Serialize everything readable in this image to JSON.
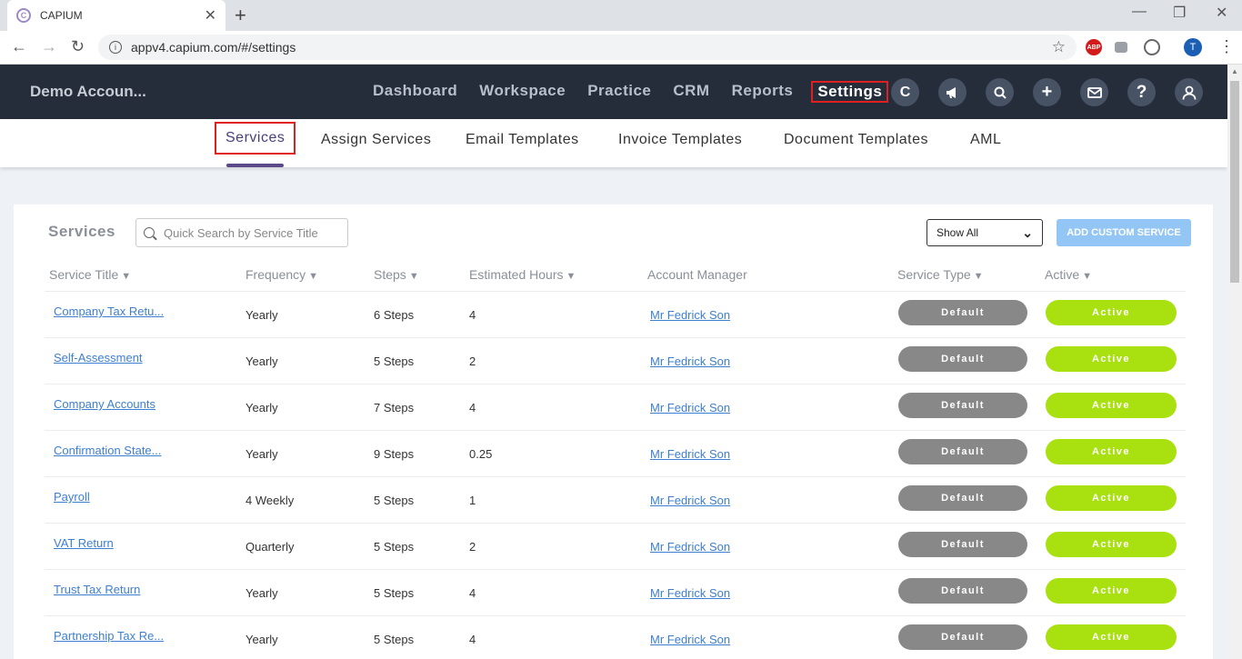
{
  "browser": {
    "tab_title": "CAPIUM",
    "tab_favicon_letter": "C",
    "url": "appv4.capium.com/#/settings",
    "profile_initial": "T",
    "ext_abp_label": "ABP"
  },
  "header": {
    "account": "Demo Accoun...",
    "nav": [
      "Dashboard",
      "Workspace",
      "Practice",
      "CRM",
      "Reports",
      "Settings"
    ],
    "active_nav": "Settings",
    "icons": [
      "capium-logo-icon",
      "megaphone-icon",
      "search-icon",
      "plus-icon",
      "mail-icon",
      "help-icon",
      "user-icon"
    ]
  },
  "subnav": {
    "items": [
      "Services",
      "Assign Services",
      "Email Templates",
      "Invoice Templates",
      "Document Templates",
      "AML"
    ],
    "active": "Services"
  },
  "panel": {
    "title": "Services",
    "search_placeholder": "Quick Search by Service Title",
    "filter_value": "Show All",
    "add_button": "ADD CUSTOM SERVICE"
  },
  "table": {
    "columns": [
      "Service Title",
      "Frequency",
      "Steps",
      "Estimated Hours",
      "Account Manager",
      "Service Type",
      "Active"
    ],
    "rows": [
      {
        "title": "Company Tax Retu...",
        "frequency": "Yearly",
        "steps": "6 Steps",
        "hours": "4",
        "manager": "Mr Fedrick Son",
        "type": "Default",
        "active": "Active"
      },
      {
        "title": "Self-Assessment",
        "frequency": "Yearly",
        "steps": "5 Steps",
        "hours": "2",
        "manager": "Mr Fedrick Son",
        "type": "Default",
        "active": "Active"
      },
      {
        "title": "Company Accounts",
        "frequency": "Yearly",
        "steps": "7 Steps",
        "hours": "4",
        "manager": "Mr Fedrick Son",
        "type": "Default",
        "active": "Active"
      },
      {
        "title": "Confirmation State...",
        "frequency": "Yearly",
        "steps": "9 Steps",
        "hours": "0.25",
        "manager": "Mr Fedrick Son",
        "type": "Default",
        "active": "Active"
      },
      {
        "title": "Payroll",
        "frequency": "4 Weekly",
        "steps": "5 Steps",
        "hours": "1",
        "manager": "Mr Fedrick Son",
        "type": "Default",
        "active": "Active"
      },
      {
        "title": "VAT Return",
        "frequency": "Quarterly",
        "steps": "5 Steps",
        "hours": "2",
        "manager": "Mr Fedrick Son",
        "type": "Default",
        "active": "Active"
      },
      {
        "title": "Trust Tax Return",
        "frequency": "Yearly",
        "steps": "5 Steps",
        "hours": "4",
        "manager": "Mr Fedrick Son",
        "type": "Default",
        "active": "Active"
      },
      {
        "title": "Partnership Tax Re...",
        "frequency": "Yearly",
        "steps": "5 Steps",
        "hours": "4",
        "manager": "Mr Fedrick Son",
        "type": "Default",
        "active": "Active"
      }
    ]
  },
  "colors": {
    "header_bg": "#262d3a",
    "highlight_border": "#e02020",
    "active_pill": "#a8e10f",
    "default_pill": "#888888",
    "link": "#3d7fd1",
    "add_button": "#93c6f5"
  }
}
